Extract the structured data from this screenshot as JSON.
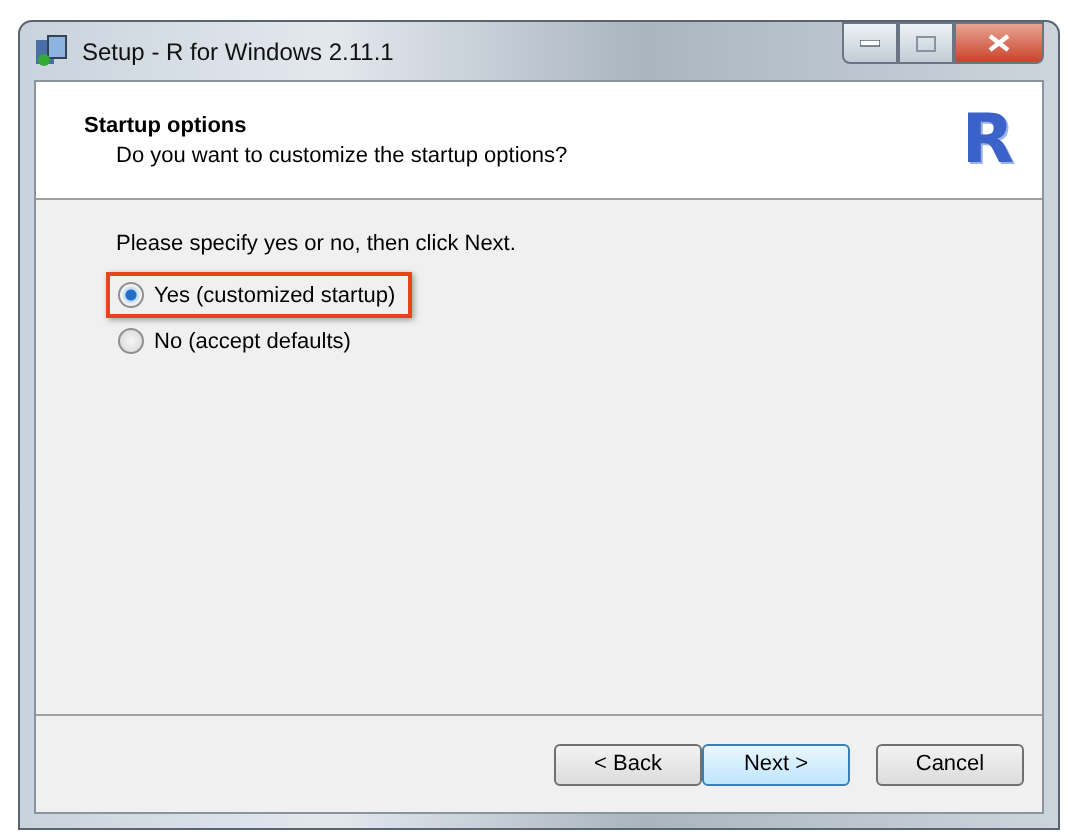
{
  "window": {
    "title": "Setup - R for Windows 2.11.1"
  },
  "header": {
    "title": "Startup options",
    "subtitle": "Do you want to customize the startup options?",
    "logo_text": "R"
  },
  "prompt": "Please specify yes or no, then click Next.",
  "options": [
    {
      "label": "Yes (customized startup)",
      "selected": true,
      "highlighted": true
    },
    {
      "label": "No (accept defaults)",
      "selected": false,
      "highlighted": false
    }
  ],
  "buttons": [
    {
      "label": "< Back",
      "default": false
    },
    {
      "label": "Next >",
      "default": true
    },
    {
      "label": "Cancel",
      "default": false
    }
  ]
}
